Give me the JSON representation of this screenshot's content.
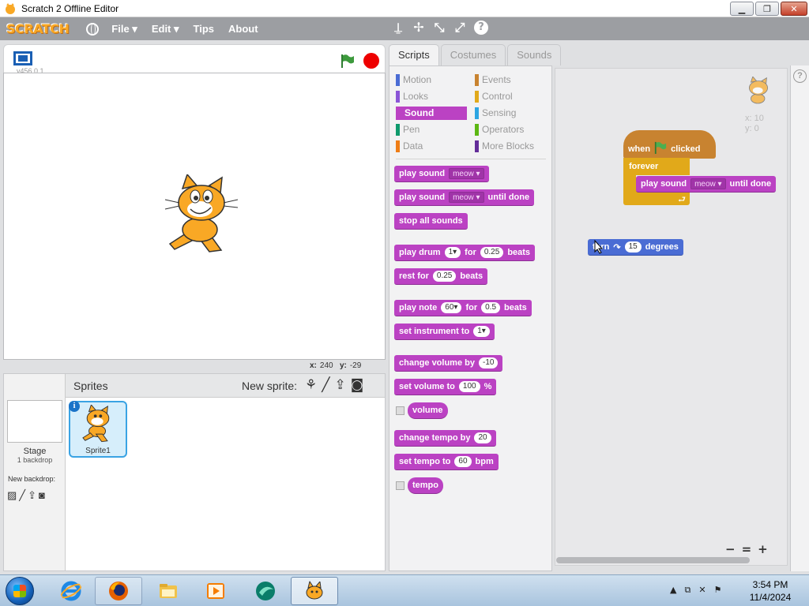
{
  "window": {
    "title": "Scratch 2 Offline Editor",
    "controls": {
      "minimize": "▁",
      "maximize": "❐",
      "close": "✕"
    }
  },
  "menubar": {
    "logo": "SCRATCH",
    "items": [
      "File ▾",
      "Edit ▾",
      "Tips",
      "About"
    ],
    "tools": [
      "⍊",
      "✢",
      "⤡",
      "⤢",
      "?"
    ]
  },
  "stage": {
    "version": "v456.0.1",
    "coords": {
      "x_label": "x:",
      "x_value": "240",
      "y_label": "y:",
      "y_value": "-29"
    }
  },
  "sprites_pane": {
    "stage_label": "Stage",
    "stage_backdrops": "1 backdrop",
    "new_backdrop": "New backdrop:",
    "sprites_title": "Sprites",
    "new_sprite": "New sprite:",
    "sprite_name": "Sprite1",
    "info_icon": "i"
  },
  "tabs": [
    "Scripts",
    "Costumes",
    "Sounds"
  ],
  "categories": [
    {
      "label": "Motion",
      "color": "#4a6cd4"
    },
    {
      "label": "Looks",
      "color": "#8a55d7"
    },
    {
      "label": "Sound",
      "color": "#bb42c3"
    },
    {
      "label": "Pen",
      "color": "#0e9a6c"
    },
    {
      "label": "Data",
      "color": "#ee7d16"
    },
    {
      "label": "Events",
      "color": "#c88330"
    },
    {
      "label": "Control",
      "color": "#e1a91a"
    },
    {
      "label": "Sensing",
      "color": "#2ca5e2"
    },
    {
      "label": "Operators",
      "color": "#5cb712"
    },
    {
      "label": "More Blocks",
      "color": "#632d99"
    }
  ],
  "blocks": {
    "play_sound": {
      "a": "play sound",
      "drop": "meow ▾"
    },
    "play_sound_until": {
      "a": "play sound",
      "drop": "meow ▾",
      "b": "until done"
    },
    "stop_all": "stop all sounds",
    "play_drum": {
      "a": "play drum",
      "n1": "1▾",
      "b": "for",
      "n2": "0.25",
      "c": "beats"
    },
    "rest_for": {
      "a": "rest for",
      "n": "0.25",
      "b": "beats"
    },
    "play_note": {
      "a": "play note",
      "n1": "60▾",
      "b": "for",
      "n2": "0.5",
      "c": "beats"
    },
    "set_instrument": {
      "a": "set instrument to",
      "n": "1▾"
    },
    "change_volume": {
      "a": "change volume by",
      "n": "-10"
    },
    "set_volume": {
      "a": "set volume to",
      "n": "100",
      "b": "%"
    },
    "volume": "volume",
    "change_tempo": {
      "a": "change tempo by",
      "n": "20"
    },
    "set_tempo": {
      "a": "set tempo to",
      "n": "60",
      "b": "bpm"
    },
    "tempo": "tempo"
  },
  "script": {
    "sprite_x": "x: 10",
    "sprite_y": "y: 0",
    "hat": {
      "a": "when",
      "b": "clicked"
    },
    "forever": "forever",
    "inner": {
      "a": "play sound",
      "drop": "meow ▾",
      "b": "until done"
    },
    "turn": {
      "a": "turn",
      "icon": "↷",
      "n": "15",
      "b": "degrees"
    },
    "zoom": [
      "−",
      "=",
      "+"
    ]
  },
  "taskbar": {
    "time": "3:54 PM",
    "date": "11/4/2024",
    "tray": [
      "▲",
      "⧉",
      "✕",
      "⚑"
    ]
  }
}
